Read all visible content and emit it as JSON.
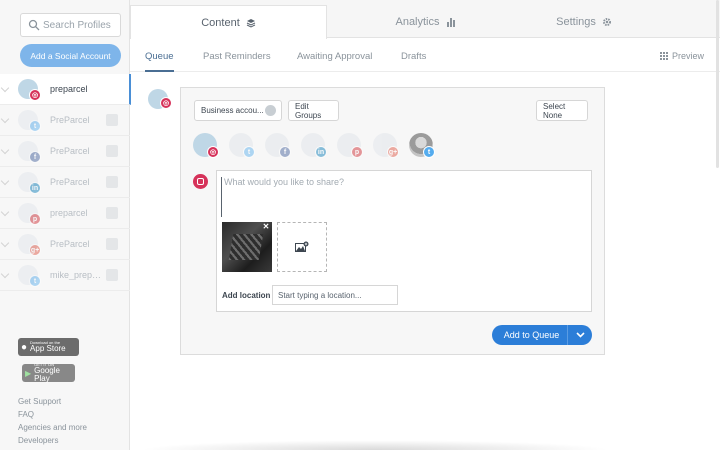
{
  "sidebar": {
    "search_placeholder": "Search Profiles",
    "add_account_label": "Add a Social Account",
    "profiles": [
      {
        "name": "preparcel",
        "network": "instagram",
        "badge_color": "#d6325a",
        "badge_glyph": "◎",
        "active": true
      },
      {
        "name": "PreParcel",
        "network": "twitter",
        "badge_color": "#55acee",
        "badge_glyph": "t",
        "active": false
      },
      {
        "name": "PreParcel",
        "network": "facebook",
        "badge_color": "#3b5998",
        "badge_glyph": "f",
        "active": false
      },
      {
        "name": "PreParcel",
        "network": "linkedin",
        "badge_color": "#0077b5",
        "badge_glyph": "in",
        "active": false
      },
      {
        "name": "preparcel",
        "network": "pinterest",
        "badge_color": "#cb2027",
        "badge_glyph": "p",
        "active": false
      },
      {
        "name": "PreParcel",
        "network": "google-plus",
        "badge_color": "#dd4b39",
        "badge_glyph": "g+",
        "active": false
      },
      {
        "name": "mike_prepa...",
        "network": "twitter",
        "badge_color": "#55acee",
        "badge_glyph": "t",
        "active": false
      }
    ],
    "app_store": {
      "small": "Download on the",
      "big": "App Store"
    },
    "google_play": {
      "small": "GET IT ON",
      "big": "Google Play"
    },
    "footer_links": [
      "Get Support",
      "FAQ",
      "Agencies and more",
      "Developers"
    ]
  },
  "top_tabs": {
    "content": "Content",
    "analytics": "Analytics",
    "settings": "Settings"
  },
  "sub_tabs": {
    "queue": "Queue",
    "past_reminders": "Past Reminders",
    "awaiting_approval": "Awaiting Approval",
    "drafts": "Drafts",
    "preview": "Preview"
  },
  "composer": {
    "business_chip": "Business accou...",
    "edit_groups": "Edit Groups",
    "select_none": "Select None",
    "placeholder": "What would you like to share?",
    "add_location_label": "Add location",
    "location_placeholder": "Start typing a location...",
    "add_to_queue": "Add to Queue",
    "avatars": [
      {
        "network": "instagram",
        "badge_color": "#d6325a",
        "badge_glyph": "◎",
        "selected": true
      },
      {
        "network": "twitter",
        "badge_color": "#55acee",
        "badge_glyph": "t",
        "selected": false
      },
      {
        "network": "facebook",
        "badge_color": "#3b5998",
        "badge_glyph": "f",
        "selected": false
      },
      {
        "network": "linkedin",
        "badge_color": "#0077b5",
        "badge_glyph": "in",
        "selected": false
      },
      {
        "network": "pinterest",
        "badge_color": "#cb2027",
        "badge_glyph": "p",
        "selected": false
      },
      {
        "network": "google-plus",
        "badge_color": "#dd4b39",
        "badge_glyph": "g+",
        "selected": false
      },
      {
        "network": "twitter",
        "badge_color": "#55acee",
        "badge_glyph": "t",
        "selected": false,
        "photo": true
      }
    ]
  },
  "colors": {
    "accent": "#2c7ed8",
    "add_account": "#7eb5ea",
    "instagram": "#d6325a"
  }
}
